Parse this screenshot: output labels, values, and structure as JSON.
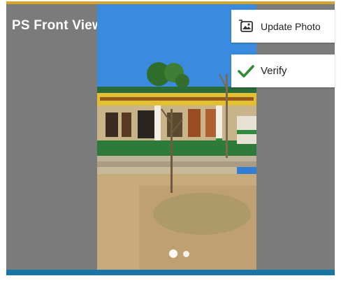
{
  "header": {
    "title": "PS Front View"
  },
  "actions": {
    "update_photo": {
      "label": "Update Photo",
      "icon": "image-edit-icon"
    },
    "verify": {
      "label": "Verify",
      "icon": "check-icon",
      "icon_color": "#2e8b2e"
    }
  },
  "carousel": {
    "total_images": 2,
    "active_index": 1
  },
  "colors": {
    "panel": "#7b7b7b",
    "top_border": "#d4a62a",
    "bottom_bar": "#1776a8"
  }
}
